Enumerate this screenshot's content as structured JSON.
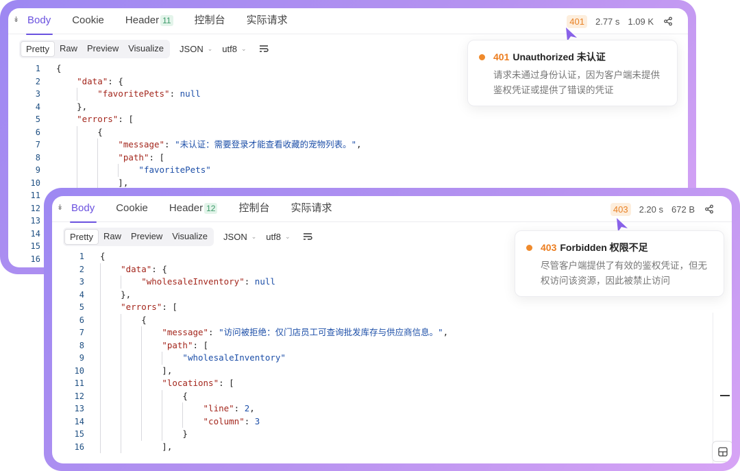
{
  "panel_a": {
    "tabs": [
      {
        "label": "Body"
      },
      {
        "label": "Cookie"
      },
      {
        "label": "Header",
        "count": "11"
      },
      {
        "label": "控制台"
      },
      {
        "label": "实际请求"
      }
    ],
    "status": "401",
    "time": "2.77 s",
    "size": "1.09 K",
    "views": [
      "Pretty",
      "Raw",
      "Preview",
      "Visualize"
    ],
    "format": "JSON",
    "encoding": "utf8",
    "popover": {
      "code": "401",
      "title": "Unauthorized 未认证",
      "desc": "请求未通过身份认证，因为客户端未提供鉴权凭证或提供了错误的凭证"
    },
    "lines": [
      "1",
      "2",
      "3",
      "4",
      "5",
      "6",
      "7",
      "8",
      "9",
      "10",
      "11",
      "12",
      "13",
      "14",
      "15",
      "16"
    ],
    "code": {
      "data_key": "\"data\"",
      "favorite_key": "\"favoritePets\"",
      "null": "null",
      "errors_key": "\"errors\"",
      "message_key": "\"message\"",
      "message_val": "\"未认证：需要登录才能查看收藏的宠物列表。\"",
      "path_key": "\"path\"",
      "path_val": "\"favoritePets\""
    }
  },
  "panel_b": {
    "tabs": [
      {
        "label": "Body"
      },
      {
        "label": "Cookie"
      },
      {
        "label": "Header",
        "count": "12"
      },
      {
        "label": "控制台"
      },
      {
        "label": "实际请求"
      }
    ],
    "status": "403",
    "time": "2.20 s",
    "size": "672 B",
    "views": [
      "Pretty",
      "Raw",
      "Preview",
      "Visualize"
    ],
    "format": "JSON",
    "encoding": "utf8",
    "popover": {
      "code": "403",
      "title": "Forbidden 权限不足",
      "desc": "尽管客户端提供了有效的鉴权凭证，但无权访问该资源，因此被禁止访问"
    },
    "lines": [
      "1",
      "2",
      "3",
      "4",
      "5",
      "6",
      "7",
      "8",
      "9",
      "10",
      "11",
      "12",
      "13",
      "14",
      "15",
      "16"
    ],
    "code": {
      "data_key": "\"data\"",
      "wholesale_key": "\"wholesaleInventory\"",
      "null": "null",
      "errors_key": "\"errors\"",
      "message_key": "\"message\"",
      "message_val": "\"访问被拒绝：仅门店员工可查询批发库存与供应商信息。\"",
      "path_key": "\"path\"",
      "path_val": "\"wholesaleInventory\"",
      "locations_key": "\"locations\"",
      "line_key": "\"line\"",
      "line_val": "2",
      "column_key": "\"column\"",
      "column_val": "3"
    }
  },
  "colors": {
    "accent": "#6a51df",
    "status_orange": "#ec7d1f",
    "json_key": "#a3261c",
    "json_string": "#1d4fa8",
    "frame_gradient": [
      "#9d88f2",
      "#d7a4f5"
    ]
  },
  "icons": [
    "collapse-icon",
    "share-icon",
    "chevron-down-icon",
    "wrap-lines-icon",
    "layout-icon"
  ]
}
